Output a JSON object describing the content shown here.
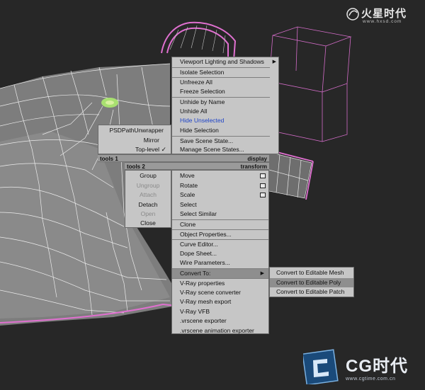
{
  "watermark_top": {
    "brand": "火星时代",
    "url": "www.hxsd.com"
  },
  "watermark_bottom": {
    "brand": "CG时代",
    "url": "www.cgtime.com.cn"
  },
  "quad_left_top": {
    "items": [
      {
        "label": "PSDPathUnwrapper"
      },
      {
        "label": "Mirror"
      },
      {
        "label": "Top-level",
        "check": "✓"
      }
    ]
  },
  "bar1": {
    "left": "tools 1",
    "right": "display"
  },
  "bar2": {
    "left": "tools 2",
    "right": "transform"
  },
  "quad_right_top": {
    "items": [
      {
        "label": "Viewport Lighting and Shadows",
        "arrow": "▶"
      },
      {
        "label": "Isolate Selection"
      },
      {
        "label": "Unfreeze All"
      },
      {
        "label": "Freeze Selection"
      },
      {
        "label": "Unhide by Name"
      },
      {
        "label": "Unhide All"
      },
      {
        "label": "Hide Unselected"
      },
      {
        "label": "Hide Selection"
      },
      {
        "label": "Save Scene State..."
      },
      {
        "label": "Manage Scene States..."
      }
    ]
  },
  "quad_left_bottom": {
    "items": [
      {
        "label": "Group"
      },
      {
        "label": "Ungroup"
      },
      {
        "label": "Attach"
      },
      {
        "label": "Detach"
      },
      {
        "label": "Open"
      },
      {
        "label": "Close"
      }
    ]
  },
  "quad_right_bottom": {
    "items": [
      {
        "label": "Move"
      },
      {
        "label": "Rotate"
      },
      {
        "label": "Scale"
      },
      {
        "label": "Select"
      },
      {
        "label": "Select Similar"
      },
      {
        "label": "Clone"
      },
      {
        "label": "Object Properties..."
      },
      {
        "label": "Curve Editor..."
      },
      {
        "label": "Dope Sheet..."
      },
      {
        "label": "Wire Parameters..."
      },
      {
        "label": "Convert To:",
        "arrow": "▶"
      },
      {
        "label": "V-Ray properties"
      },
      {
        "label": "V-Ray scene converter"
      },
      {
        "label": "V-Ray mesh export"
      },
      {
        "label": "V-Ray VFB"
      },
      {
        "label": ".vrscene exporter"
      },
      {
        "label": ".vrscene animation exporter"
      }
    ]
  },
  "convert_submenu": {
    "items": [
      {
        "label": "Convert to Editable Mesh"
      },
      {
        "label": "Convert to Editable Poly"
      },
      {
        "label": "Convert to Editable Patch"
      }
    ]
  },
  "colors": {
    "menu_bg": "#c6c6c6",
    "highlight": "#8e8e8e",
    "blue_text": "#1f44c8",
    "disabled_text": "#8a8a8a",
    "wire_white": "#e8e8e8",
    "wire_pink": "#e070d0",
    "wire_orange": "#e8a040",
    "selection_green": "#a8e070"
  }
}
